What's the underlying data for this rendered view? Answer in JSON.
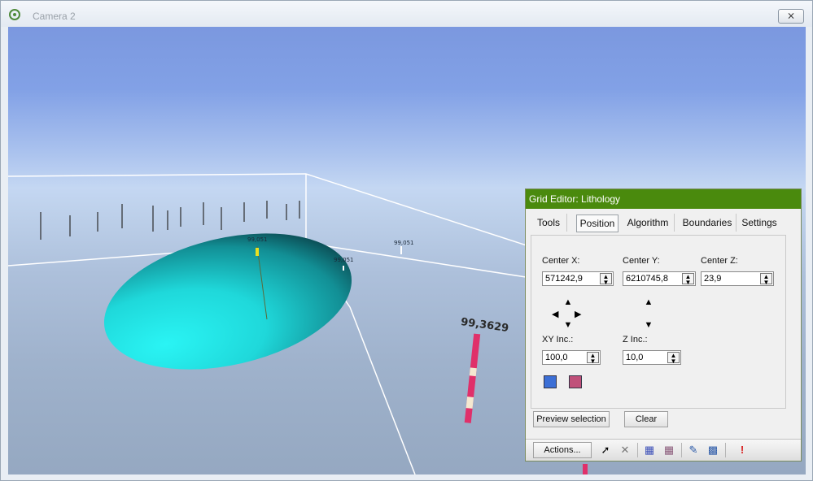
{
  "window": {
    "title": "Camera 2",
    "close_label": "⨯"
  },
  "scene": {
    "labels": [
      "99,051",
      "99,051",
      "99,051",
      "99,3629"
    ]
  },
  "grid_editor": {
    "title": "Grid Editor: Lithology",
    "tabs": [
      "Tools",
      "Position",
      "Algorithm",
      "Boundaries",
      "Settings"
    ],
    "active_tab": "Position",
    "center_x": {
      "label": "Center X:",
      "value": "571242,9"
    },
    "center_y": {
      "label": "Center Y:",
      "value": "6210745,8"
    },
    "center_z": {
      "label": "Center Z:",
      "value": "23,9"
    },
    "xy_inc": {
      "label": "XY Inc.:",
      "value": "100,0"
    },
    "z_inc": {
      "label": "Z Inc.:",
      "value": "10,0"
    },
    "preview_label": "Preview selection",
    "clear_label": "Clear",
    "actions_label": "Actions...",
    "toolbar_icons": [
      "pointer-icon",
      "delete-icon",
      "select-cells-icon",
      "deselect-cells-icon",
      "picker-icon",
      "grid-fill-icon",
      "alert-icon"
    ]
  },
  "colors": {
    "header": "#4a8a0d",
    "ellipsoid": "#22e6e6",
    "well": "#e0306a"
  }
}
